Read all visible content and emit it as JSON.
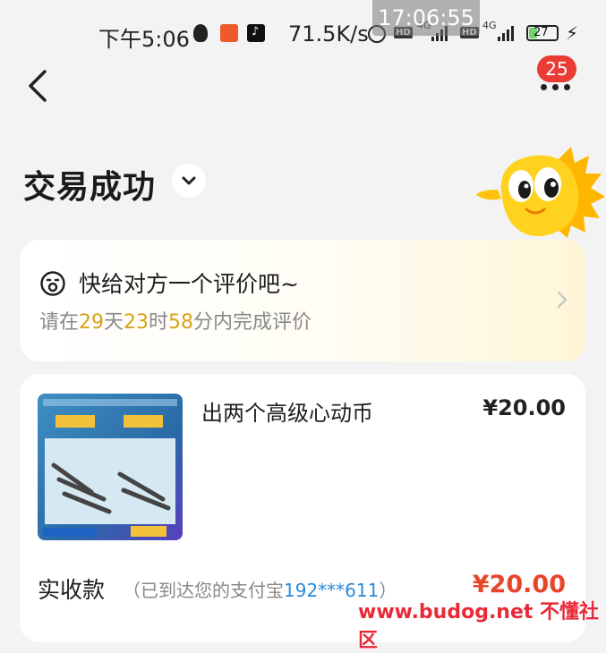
{
  "status_bar": {
    "time": "下午5:06",
    "net_speed": "71.5K/s",
    "network_hd": "HD",
    "network_type": "4G",
    "battery": "27"
  },
  "overlay_clock": "17:06:55",
  "nav": {
    "more_badge_count": "25"
  },
  "header": {
    "title": "交易成功"
  },
  "review": {
    "title": "快给对方一个评价吧~",
    "deadline_prefix": "请在",
    "days": "29",
    "days_unit": "天",
    "hours": "23",
    "hours_unit": "时",
    "minutes": "58",
    "minutes_unit": "分内完成评价"
  },
  "order": {
    "product_title": "出两个高级心动币",
    "price": "¥20.00",
    "received_label": "实收款",
    "received_note_prefix": "（已到达您的支付宝",
    "received_account": "192***611",
    "received_note_suffix": "）",
    "received_amount": "¥20.00"
  },
  "watermark": {
    "text": "www.budog.net 不懂社区"
  },
  "colors": {
    "accent_orange": "#e8462a",
    "highlight_gold": "#d8a21a",
    "badge_red": "#ea3c35",
    "link_blue": "#2d8ad8"
  }
}
